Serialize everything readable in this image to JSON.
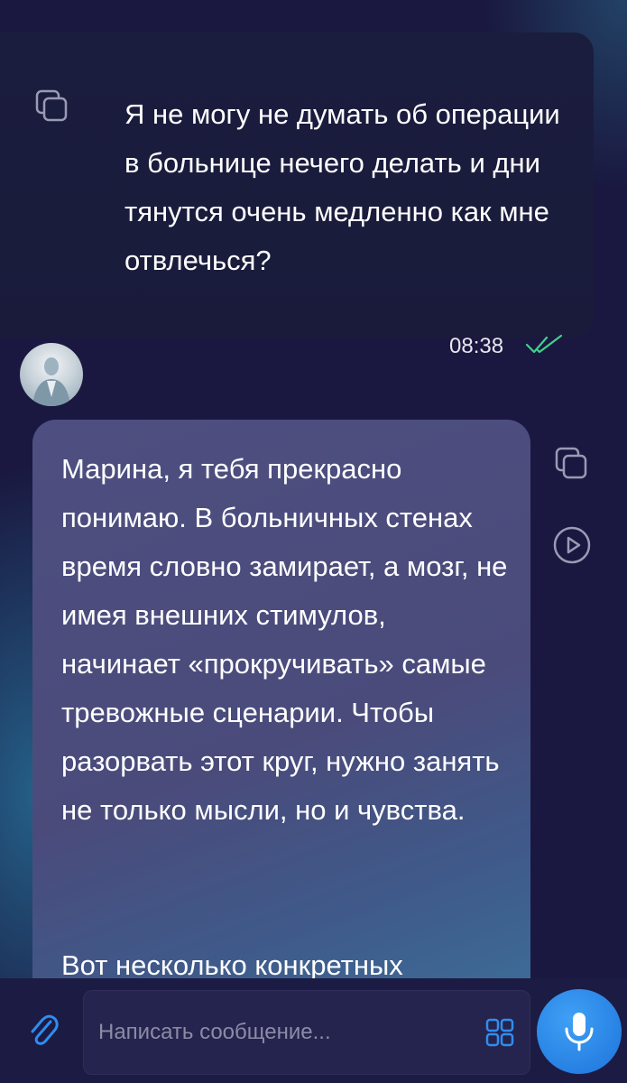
{
  "chat": {
    "outgoing": {
      "text": "Я не могу не думать об операции в больнице нечего делать и дни тянутся очень медленно как мне отвлечься?",
      "time": "08:38",
      "status_icon": "double-check-icon",
      "copy_icon": "copy-icon"
    },
    "incoming": {
      "avatar": "avatar",
      "paragraph1": "Марина, я тебя прекрасно понимаю. В больничных стенах время словно замирает, а мозг, не имея внешних стимулов, начинает «прокручивать» самые тревожные сценарии. Чтобы разорвать этот круг, нужно занять не только мысли, но и чувства.",
      "paragraph2": "Вот несколько конкретных",
      "copy_icon": "copy-icon",
      "play_icon": "play-icon"
    }
  },
  "composer": {
    "placeholder": "Написать сообщение...",
    "attach_icon": "paperclip-icon",
    "grid_icon": "grid-icon",
    "mic_icon": "microphone-icon"
  },
  "colors": {
    "background": "#1a1840",
    "bubble_out": "#1b1d3e",
    "bubble_in": "#4e4f80",
    "accent": "#1d73db",
    "check": "#3fd38a"
  }
}
